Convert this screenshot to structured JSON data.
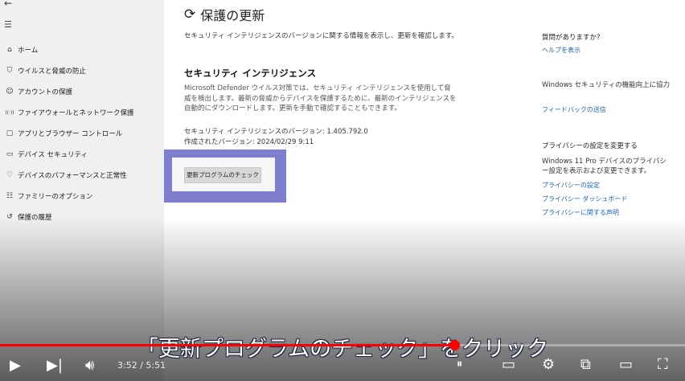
{
  "sidebar": {
    "back_icon": "back-arrow-icon",
    "menu_icon": "hamburger-icon",
    "items": [
      {
        "label": "ホーム",
        "icon": "home-icon"
      },
      {
        "label": "ウイルスと脅威の防止",
        "icon": "shield-icon"
      },
      {
        "label": "アカウントの保護",
        "icon": "person-icon"
      },
      {
        "label": "ファイアウォールとネットワーク保護",
        "icon": "wifi-icon"
      },
      {
        "label": "アプリとブラウザー コントロール",
        "icon": "app-browser-icon"
      },
      {
        "label": "デバイス セキュリティ",
        "icon": "laptop-icon"
      },
      {
        "label": "デバイスのパフォーマンスと正常性",
        "icon": "heart-icon"
      },
      {
        "label": "ファミリーのオプション",
        "icon": "family-icon"
      },
      {
        "label": "保護の履歴",
        "icon": "history-icon"
      }
    ]
  },
  "main": {
    "title": "保護の更新",
    "description": "セキュリティ インテリジェンスのバージョンに関する情報を表示し、更新を確認します。",
    "section_title": "セキュリティ インテリジェンス",
    "section_body": "Microsoft Defender ウイルス対策では、セキュリティ インテリジェンスを使用して脅威を検出します。最新の脅威からデバイスを保護するために、最新のインテリジェンスを自動的にダウンロードします。更新を手動で確認することもできます。",
    "version_line": "セキュリティ インテリジェンスのバージョン: 1.405.792.0",
    "created_line": "作成されたバージョン: 2024/02/29 9:11",
    "check_button": "更新プログラムのチェック",
    "highlight_color": "#7d7fce"
  },
  "right": {
    "q_heading": "質問がありますか?",
    "help_link": "ヘルプを表示",
    "improve_heading": "Windows セキュリティの機能向上に協力",
    "feedback_link": "フィードバックの送信",
    "privacy_heading": "プライバシーの設定を変更する",
    "privacy_body": "Windows 11 Pro デバイスのプライバシー設定を表示および変更できます。",
    "privacy_links": [
      "プライバシーの設定",
      "プライバシー ダッシュボード",
      "プライバシーに関する声明"
    ]
  },
  "player": {
    "caption": "「更新プログラムのチェック」をクリック",
    "time_current": "3:52",
    "time_total": "5:51",
    "progress_fraction": 0.663,
    "accent": "#ff0000"
  }
}
